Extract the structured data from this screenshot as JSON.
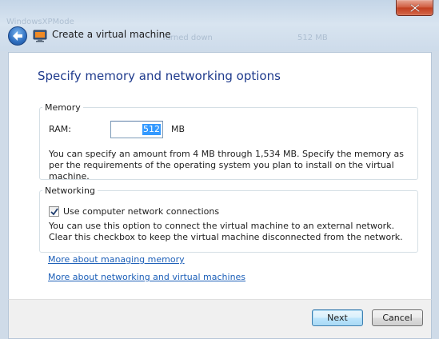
{
  "window": {
    "title": "Create a virtual machine",
    "background_text": [
      "WindowsXPMode",
      "Turned down",
      "512 MB"
    ]
  },
  "page": {
    "heading": "Specify memory and networking options"
  },
  "memory": {
    "group_label": "Memory",
    "ram_label": "RAM:",
    "ram_value": "512",
    "ram_unit": "MB",
    "description": "You can specify an amount from 4 MB through 1,534 MB. Specify the memory as per the requirements of the operating system you plan to install on the virtual machine."
  },
  "networking": {
    "group_label": "Networking",
    "checkbox_label": "Use computer network connections",
    "checkbox_checked": true,
    "description": "You can use this option to connect the virtual machine to an external network. Clear this checkbox to keep the virtual machine disconnected from the network."
  },
  "links": {
    "memory": "More about managing memory",
    "networking": "More about networking and virtual machines"
  },
  "buttons": {
    "next": "Next",
    "cancel": "Cancel"
  },
  "colors": {
    "heading": "#1e3a8c",
    "link": "#1c5fb8",
    "selection": "#3399ff"
  }
}
